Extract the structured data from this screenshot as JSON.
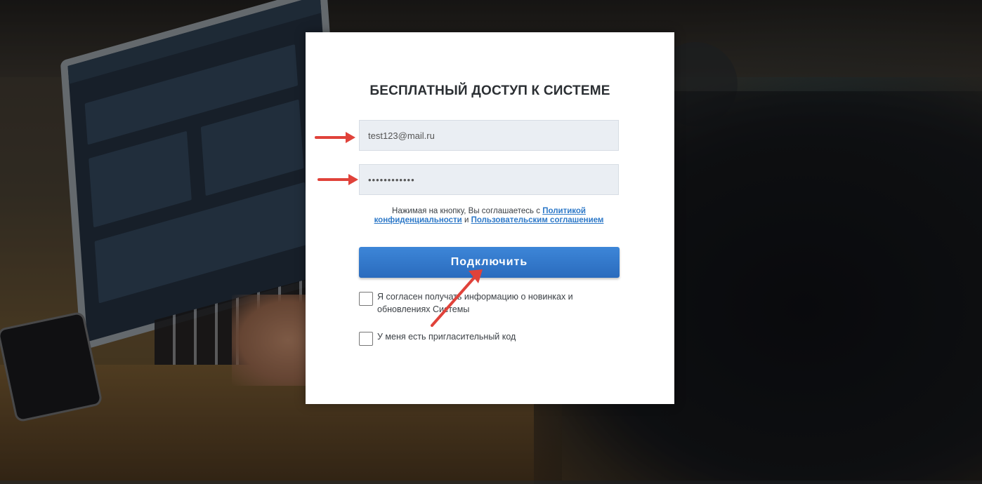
{
  "form": {
    "title": "БЕСПЛАТНЫЙ ДОСТУП К СИСТЕМЕ",
    "email_value": "test123@mail.ru",
    "password_value": "••••••••••••",
    "agreement_prefix": "Нажимая на кнопку, Вы соглашаетесь с ",
    "privacy_link": "Политикой конфиденциальности",
    "agreement_and": " и ",
    "terms_link": "Пользовательским соглашением",
    "submit_label": "Подключить",
    "checkbox_news_label": "Я согласен получать информацию о новинках и обновлениях Системы",
    "checkbox_invite_label": "У меня есть пригласительный код"
  },
  "colors": {
    "button": "#2f74c6",
    "link": "#2e79c8",
    "annotation_arrow": "#e0423a"
  }
}
